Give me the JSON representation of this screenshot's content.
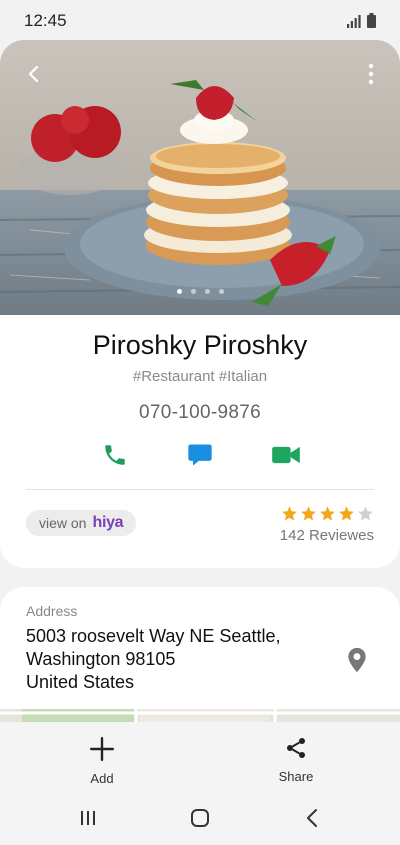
{
  "status": {
    "time": "12:45"
  },
  "contact": {
    "name": "Piroshky Piroshky",
    "tags": "#Restaurant #Italian",
    "phone": "070-100-9876"
  },
  "hero": {
    "page_count": 4,
    "active_page": 1
  },
  "hiya": {
    "prefix": "view on",
    "brand": "hiya"
  },
  "rating": {
    "stars": 4,
    "max": 5,
    "reviews": "142 Reviewes"
  },
  "address": {
    "label": "Address",
    "line1": "5003 roosevelt Way NE Seattle,",
    "line2": "Washington 98105",
    "line3": "United States"
  },
  "bottom_actions": {
    "add": "Add",
    "share": "Share"
  },
  "colors": {
    "call": "#1e9e5a",
    "message": "#1a8fe0",
    "video": "#1fa65e",
    "star": "#f3a81b",
    "hiya": "#7b3fb5"
  },
  "icons": [
    "back-icon",
    "more-icon",
    "phone-icon",
    "message-icon",
    "video-icon",
    "star-icon",
    "location-pin-icon",
    "add-icon",
    "share-icon",
    "recents-icon",
    "home-icon",
    "back-nav-icon"
  ]
}
